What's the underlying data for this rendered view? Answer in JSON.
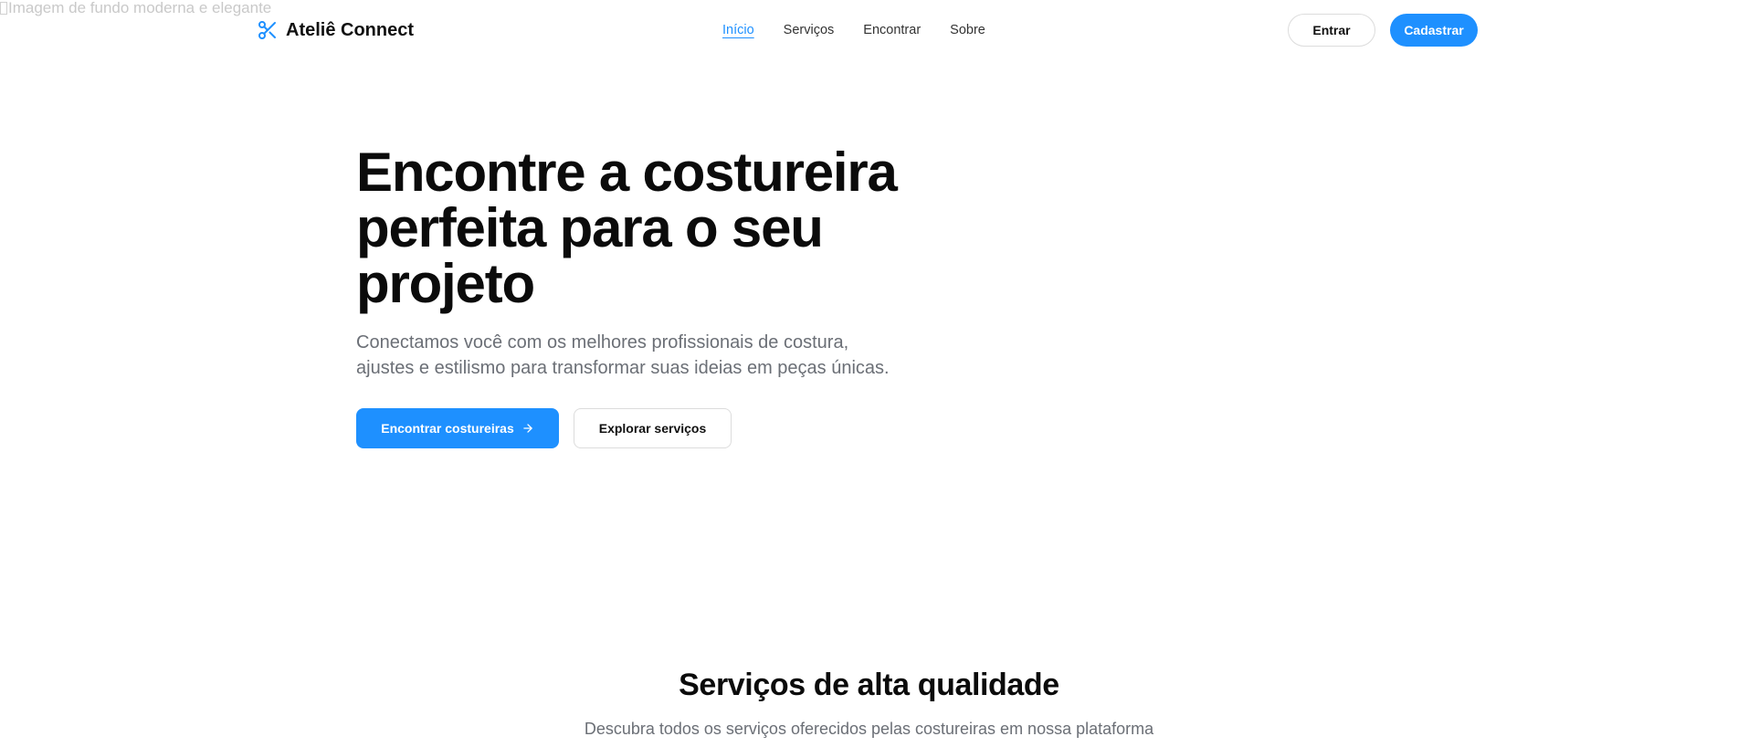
{
  "background_image": {
    "alt_text": "Imagem de fundo moderna e elegante"
  },
  "header": {
    "brand": {
      "name": "Ateliê Connect",
      "icon": "scissors-icon"
    },
    "nav": [
      {
        "label": "Início",
        "active": true
      },
      {
        "label": "Serviços",
        "active": false
      },
      {
        "label": "Encontrar",
        "active": false
      },
      {
        "label": "Sobre",
        "active": false
      }
    ],
    "login_label": "Entrar",
    "signup_label": "Cadastrar"
  },
  "hero": {
    "title": "Encontre a costureira perfeita para o seu projeto",
    "subtitle": "Conectamos você com os melhores profissionais de costura, ajustes e estilismo para transformar suas ideias em peças únicas.",
    "primary_button": {
      "label": "Encontrar costureiras",
      "icon": "arrow-right-icon"
    },
    "secondary_button": {
      "label": "Explorar serviços"
    }
  },
  "services_section": {
    "title": "Serviços de alta qualidade",
    "subtitle": "Descubra todos os serviços oferecidos pelas costureiras em nossa plataforma"
  },
  "colors": {
    "accent": "#1e90ff",
    "text_primary": "#0b0b0b",
    "text_muted": "#6b6f76"
  }
}
